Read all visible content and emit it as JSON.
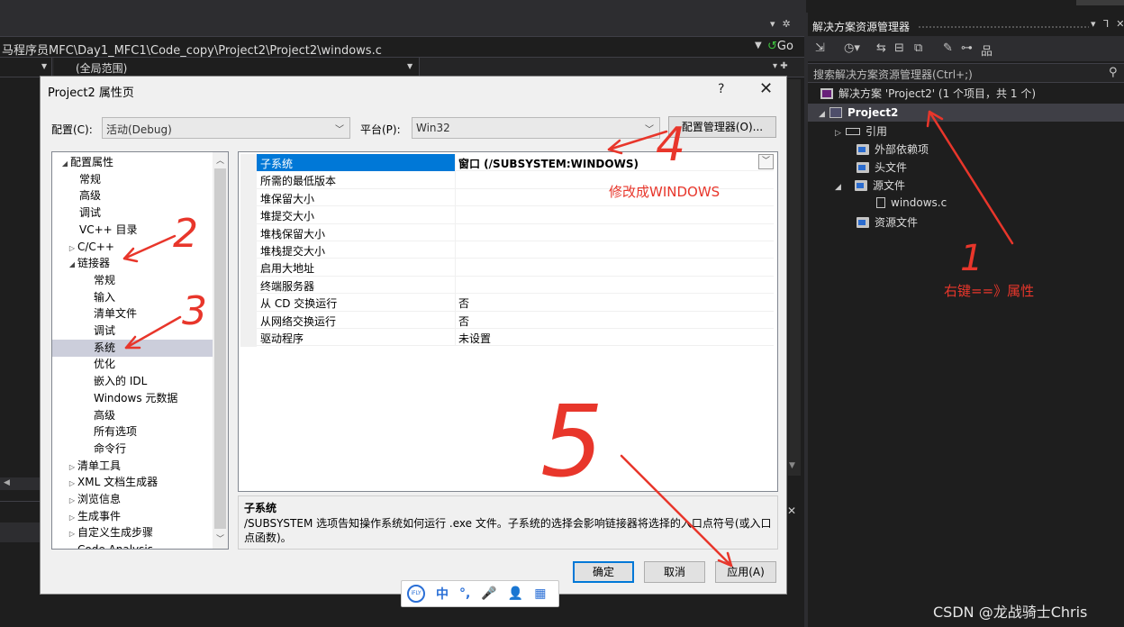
{
  "ide": {
    "file_path": "马程序员MFC\\Day1_MFC1\\Code_copy\\Project2\\Project2\\windows.c",
    "go_label": "Go",
    "scope": "(全局范围)"
  },
  "solution_explorer": {
    "title": "解决方案资源管理器",
    "search_placeholder": "搜索解决方案资源管理器(Ctrl+;)",
    "solution_label": "解决方案 'Project2' (1 个项目，共 1 个)",
    "project_label": "Project2",
    "items": [
      {
        "label": "引用"
      },
      {
        "label": "外部依赖项"
      },
      {
        "label": "头文件"
      },
      {
        "label": "源文件"
      },
      {
        "label": "windows.c"
      },
      {
        "label": "资源文件"
      }
    ]
  },
  "dialog": {
    "title": "Project2 属性页",
    "help": "?",
    "close": "✕",
    "config_label": "配置(C):",
    "config_value": "活动(Debug)",
    "platform_label": "平台(P):",
    "platform_value": "Win32",
    "config_manager_button": "配置管理器(O)...",
    "tree": [
      {
        "label": "配置属性",
        "expander": "◢"
      },
      {
        "label": "常规"
      },
      {
        "label": "高级"
      },
      {
        "label": "调试"
      },
      {
        "label": "VC++ 目录"
      },
      {
        "label": "C/C++",
        "expander": "▷"
      },
      {
        "label": "链接器",
        "expander": "◢"
      },
      {
        "label": "常规"
      },
      {
        "label": "输入"
      },
      {
        "label": "清单文件"
      },
      {
        "label": "调试"
      },
      {
        "label": "系统"
      },
      {
        "label": "优化"
      },
      {
        "label": "嵌入的 IDL"
      },
      {
        "label": "Windows 元数据"
      },
      {
        "label": "高级"
      },
      {
        "label": "所有选项"
      },
      {
        "label": "命令行"
      },
      {
        "label": "清单工具",
        "expander": "▷"
      },
      {
        "label": "XML 文档生成器",
        "expander": "▷"
      },
      {
        "label": "浏览信息",
        "expander": "▷"
      },
      {
        "label": "生成事件",
        "expander": "▷"
      },
      {
        "label": "自定义生成步骤",
        "expander": "▷"
      },
      {
        "label": "Code Analysis",
        "expander": "▷"
      }
    ],
    "properties": [
      {
        "key": "子系统",
        "value": "窗口 (/SUBSYSTEM:WINDOWS)"
      },
      {
        "key": "所需的最低版本",
        "value": ""
      },
      {
        "key": "堆保留大小",
        "value": ""
      },
      {
        "key": "堆提交大小",
        "value": ""
      },
      {
        "key": "堆栈保留大小",
        "value": ""
      },
      {
        "key": "堆栈提交大小",
        "value": ""
      },
      {
        "key": "启用大地址",
        "value": ""
      },
      {
        "key": "终端服务器",
        "value": ""
      },
      {
        "key": "从 CD 交换运行",
        "value": "否"
      },
      {
        "key": "从网络交换运行",
        "value": "否"
      },
      {
        "key": "驱动程序",
        "value": "未设置"
      }
    ],
    "description_title": "子系统",
    "description_text": "/SUBSYSTEM 选项告知操作系统如何运行 .exe 文件。子系统的选择会影响链接器将选择的入口点符号(或入口点函数)。",
    "ok_button": "确定",
    "cancel_button": "取消",
    "apply_button": "应用(A)"
  },
  "ime": {
    "logo": "iFLY",
    "items": [
      "中",
      "°,",
      "🎤",
      "👤",
      "▦"
    ]
  },
  "annotations": {
    "num1": "1",
    "num2": "2",
    "num3": "3",
    "num4": "4",
    "num5": "5",
    "note_right_click": "右键==》属性",
    "note_modify": "修改成WINDOWS",
    "color": "#e8362b"
  },
  "watermark": "CSDN @龙战骑士Chris"
}
